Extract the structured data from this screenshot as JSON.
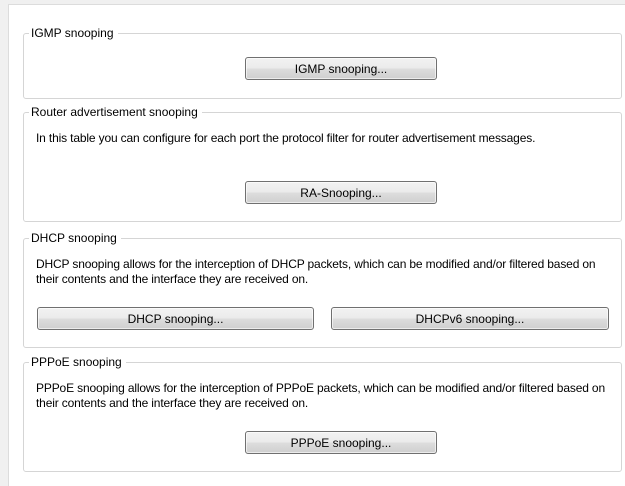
{
  "igmp": {
    "title": "IGMP snooping",
    "button_label": "IGMP snooping..."
  },
  "router_advertisement": {
    "title": "Router advertisement snooping",
    "description": "In this table you can configure for each port the protocol filter for router advertisement messages.",
    "button_label": "RA-Snooping..."
  },
  "dhcp": {
    "title": "DHCP snooping",
    "description": "DHCP snooping allows for the interception of DHCP packets, which can be modified and/or filtered based on their contents and the interface they are received on.",
    "button_label": "DHCP snooping...",
    "button_v6_label": "DHCPv6 snooping..."
  },
  "pppoe": {
    "title": "PPPoE snooping",
    "description": "PPPoE snooping allows for the interception of PPPoE packets, which can be modified and/or filtered based on their contents and the interface they are received on.",
    "button_label": "PPPoE snooping..."
  }
}
